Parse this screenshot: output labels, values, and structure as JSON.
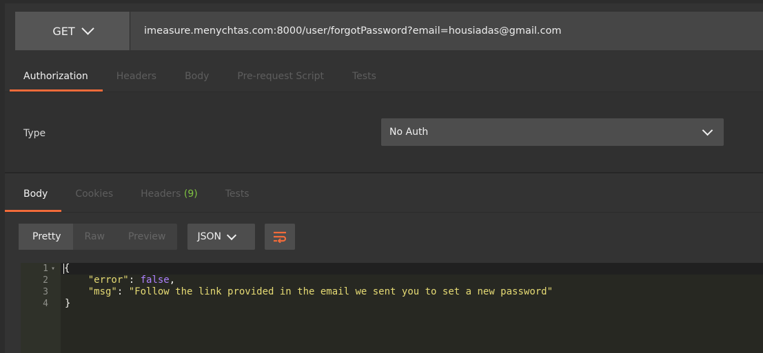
{
  "request": {
    "method": "GET",
    "url": "imeasure.menychtas.com:8000/user/forgotPassword?email=housiadas@gmail.com"
  },
  "request_tabs": [
    {
      "label": "Authorization",
      "active": true
    },
    {
      "label": "Headers",
      "active": false
    },
    {
      "label": "Body",
      "active": false
    },
    {
      "label": "Pre-request Script",
      "active": false
    },
    {
      "label": "Tests",
      "active": false
    }
  ],
  "auth": {
    "type_label": "Type",
    "type_value": "No Auth"
  },
  "response_tabs": [
    {
      "label": "Body",
      "active": true
    },
    {
      "label": "Cookies",
      "active": false
    },
    {
      "label": "Headers",
      "count": "(9)",
      "active": false
    },
    {
      "label": "Tests",
      "active": false
    }
  ],
  "format": {
    "modes": [
      "Pretty",
      "Raw",
      "Preview"
    ],
    "active_mode": "Pretty",
    "language": "JSON"
  },
  "editor": {
    "lines": [
      {
        "n": "1",
        "text": "{"
      },
      {
        "n": "2",
        "key": "\"error\"",
        "value": "false"
      },
      {
        "n": "3",
        "key": "\"msg\"",
        "value": "\"Follow the link provided in the email we sent you to set a new password\""
      },
      {
        "n": "4",
        "text": "}"
      }
    ]
  },
  "colors": {
    "accent": "#f26b3a",
    "count_green": "#7fc242",
    "json_string": "#e6db74",
    "json_boolean": "#ae81ff"
  }
}
